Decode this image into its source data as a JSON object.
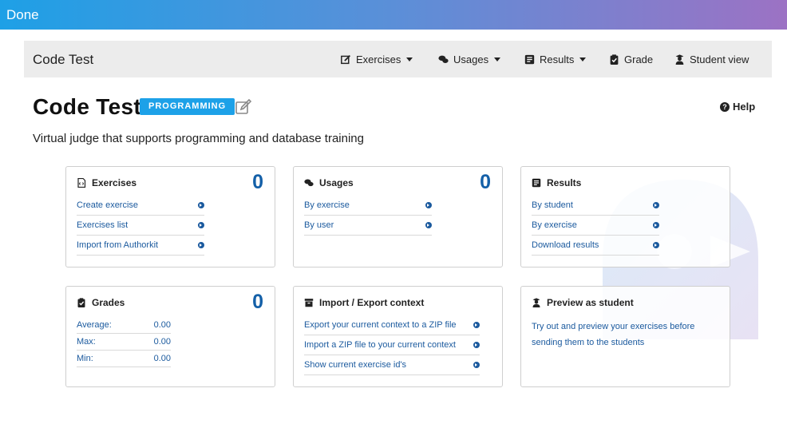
{
  "topbar": {
    "done_label": "Done"
  },
  "navbar": {
    "brand": "Code Test",
    "items": [
      {
        "label": "Exercises",
        "icon": "edit-icon",
        "dropdown": true
      },
      {
        "label": "Usages",
        "icon": "comments-icon",
        "dropdown": true
      },
      {
        "label": "Results",
        "icon": "list-icon",
        "dropdown": true
      },
      {
        "label": "Grade",
        "icon": "clipboard-check-icon",
        "dropdown": false
      },
      {
        "label": "Student view",
        "icon": "user-graduate-icon",
        "dropdown": false
      }
    ]
  },
  "header": {
    "title": "Code Test",
    "badge": "PROGRAMMING",
    "help_label": "Help",
    "subtitle": "Virtual judge that supports programming and database training"
  },
  "cards": {
    "exercises": {
      "title": "Exercises",
      "count": "0",
      "links": [
        "Create exercise",
        "Exercises list",
        "Import from Authorkit"
      ]
    },
    "usages": {
      "title": "Usages",
      "count": "0",
      "links": [
        "By exercise",
        "By user"
      ]
    },
    "results": {
      "title": "Results",
      "links": [
        "By student",
        "By exercise",
        "Download results"
      ]
    },
    "grades": {
      "title": "Grades",
      "count": "0",
      "stats": [
        {
          "label": "Average:",
          "value": "0.00"
        },
        {
          "label": "Max:",
          "value": "0.00"
        },
        {
          "label": "Min:",
          "value": "0.00"
        }
      ]
    },
    "import_export": {
      "title": "Import / Export context",
      "links": [
        "Export your current context to a ZIP file",
        "Import a ZIP file to your current context",
        "Show current exercise id's"
      ]
    },
    "preview": {
      "title": "Preview as student",
      "text": "Try out and preview your exercises before sending them to the students"
    }
  },
  "colors": {
    "accent": "#1da1e8",
    "link": "#1b5a9e",
    "count": "#1460a8"
  }
}
